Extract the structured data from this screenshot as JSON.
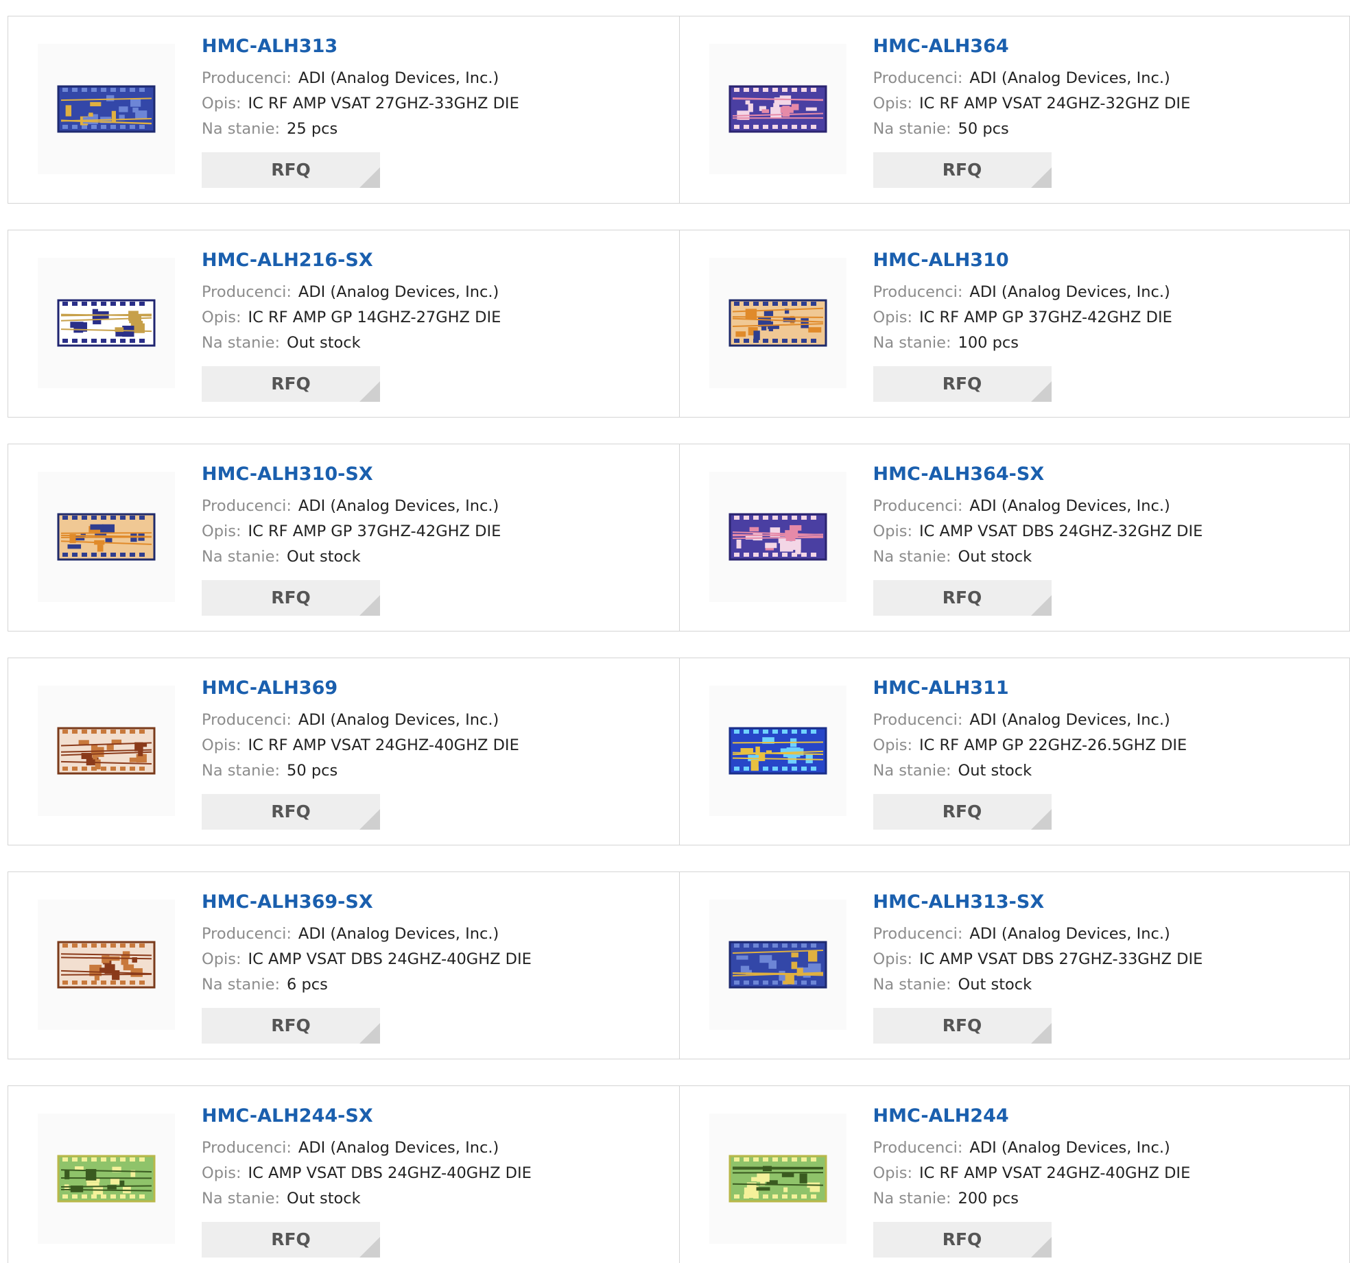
{
  "labels": {
    "manufacturer": "Producenci:",
    "description": "Opis:",
    "stock": "Na stanie:",
    "rfq": "RFQ"
  },
  "colors": {
    "part_link": "#1a5fae",
    "label_gray": "#8c8c8c",
    "button_bg": "#eeeeee",
    "border": "#d4d4d4"
  },
  "products": [
    {
      "part": "HMC-ALH313",
      "manufacturer": "ADI (Analog Devices, Inc.)",
      "description": "IC RF AMP VSAT 27GHZ-33GHZ DIE",
      "stock": "25 pcs",
      "image": "blue-chip-icon"
    },
    {
      "part": "HMC-ALH364",
      "manufacturer": "ADI (Analog Devices, Inc.)",
      "description": "IC RF AMP VSAT 24GHZ-32GHZ DIE",
      "stock": "50 pcs",
      "image": "pink-chip-icon"
    },
    {
      "part": "HMC-ALH216-SX",
      "manufacturer": "ADI (Analog Devices, Inc.)",
      "description": "IC RF AMP GP 14GHZ-27GHZ DIE",
      "stock": "Out stock",
      "image": "navy-chip-icon"
    },
    {
      "part": "HMC-ALH310",
      "manufacturer": "ADI (Analog Devices, Inc.)",
      "description": "IC RF AMP GP 37GHZ-42GHZ DIE",
      "stock": "100 pcs",
      "image": "orange-chip-icon"
    },
    {
      "part": "HMC-ALH310-SX",
      "manufacturer": "ADI (Analog Devices, Inc.)",
      "description": "IC RF AMP GP 37GHZ-42GHZ DIE",
      "stock": "Out stock",
      "image": "orange-chip-icon"
    },
    {
      "part": "HMC-ALH364-SX",
      "manufacturer": "ADI (Analog Devices, Inc.)",
      "description": "IC AMP VSAT DBS 24GHZ-32GHZ DIE",
      "stock": "Out stock",
      "image": "pink-chip-icon"
    },
    {
      "part": "HMC-ALH369",
      "manufacturer": "ADI (Analog Devices, Inc.)",
      "description": "IC RF AMP VSAT 24GHZ-40GHZ DIE",
      "stock": "50 pcs",
      "image": "copper-chip-icon"
    },
    {
      "part": "HMC-ALH311",
      "manufacturer": "ADI (Analog Devices, Inc.)",
      "description": "IC RF AMP GP 22GHZ-26.5GHZ DIE",
      "stock": "Out stock",
      "image": "cyan-chip-icon"
    },
    {
      "part": "HMC-ALH369-SX",
      "manufacturer": "ADI (Analog Devices, Inc.)",
      "description": "IC AMP VSAT DBS 24GHZ-40GHZ DIE",
      "stock": "6 pcs",
      "image": "copper-chip-icon"
    },
    {
      "part": "HMC-ALH313-SX",
      "manufacturer": "ADI (Analog Devices, Inc.)",
      "description": "IC AMP VSAT DBS 27GHZ-33GHZ DIE",
      "stock": "Out stock",
      "image": "blue-chip-icon"
    },
    {
      "part": "HMC-ALH244-SX",
      "manufacturer": "ADI (Analog Devices, Inc.)",
      "description": "IC AMP VSAT DBS 24GHZ-40GHZ DIE",
      "stock": "Out stock",
      "image": "green-chip-icon"
    },
    {
      "part": "HMC-ALH244",
      "manufacturer": "ADI (Analog Devices, Inc.)",
      "description": "IC RF AMP VSAT 24GHZ-40GHZ DIE",
      "stock": "200 pcs",
      "image": "green-chip-icon"
    }
  ]
}
